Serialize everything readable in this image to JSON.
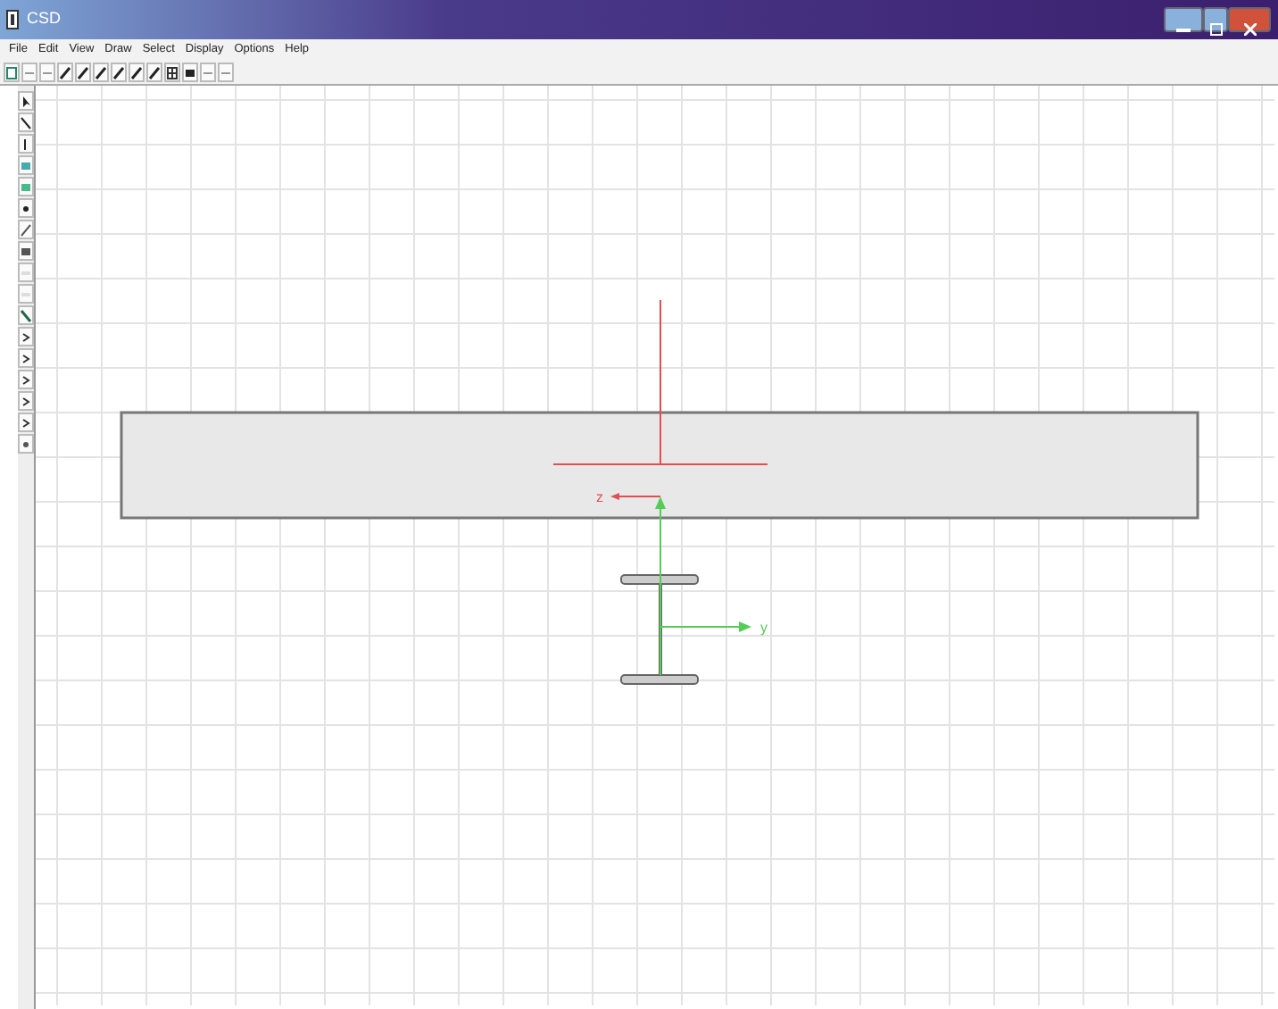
{
  "window": {
    "title": "CSD"
  },
  "menu": [
    "File",
    "Edit",
    "View",
    "Draw",
    "Select",
    "Display",
    "Options",
    "Help"
  ],
  "axes": [
    {
      "kind": "local",
      "label": "z"
    },
    {
      "kind": "section",
      "label": "y"
    }
  ]
}
